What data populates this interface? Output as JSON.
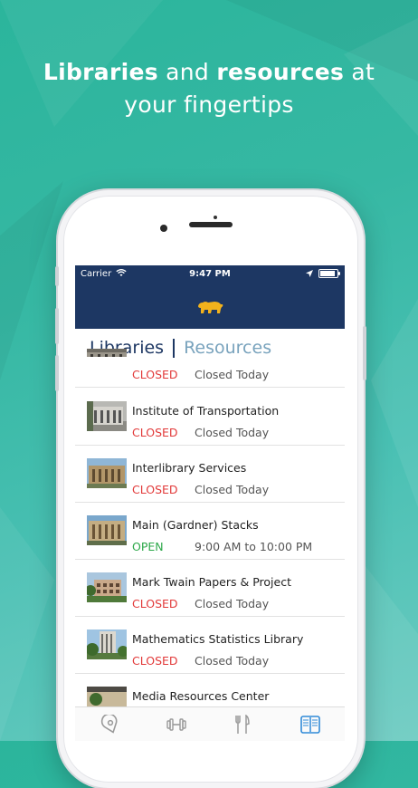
{
  "headline": {
    "line1_a": "Libraries",
    "line1_b": " and ",
    "line1_c": "resources",
    "line1_d": " at",
    "line2": "your fingertips"
  },
  "status_bar": {
    "carrier": "Carrier",
    "time": "9:47 PM"
  },
  "segmented": {
    "libraries": "Libraries",
    "resources": "Resources"
  },
  "libraries": [
    {
      "name": "",
      "state": "CLOSED",
      "state_type": "closed",
      "hours": "Closed Today",
      "icon": "building-photo"
    },
    {
      "name": "Institute of Transportation",
      "state": "CLOSED",
      "state_type": "closed",
      "hours": "Closed Today",
      "icon": "building-photo"
    },
    {
      "name": "Interlibrary Services",
      "state": "CLOSED",
      "state_type": "closed",
      "hours": "Closed Today",
      "icon": "building-photo"
    },
    {
      "name": "Main (Gardner) Stacks",
      "state": "OPEN",
      "state_type": "open",
      "hours": "9:00 AM to 10:00 PM",
      "icon": "building-photo"
    },
    {
      "name": "Mark Twain Papers & Project",
      "state": "CLOSED",
      "state_type": "closed",
      "hours": "Closed Today",
      "icon": "building-photo"
    },
    {
      "name": "Mathematics Statistics Library",
      "state": "CLOSED",
      "state_type": "closed",
      "hours": "Closed Today",
      "icon": "building-photo"
    },
    {
      "name": "Media Resources Center",
      "state": "",
      "state_type": "closed",
      "hours": "",
      "icon": "building-photo"
    }
  ],
  "colors": {
    "navy": "#1d3763",
    "closed": "#e23a3a",
    "open": "#2da84a",
    "accent_blue": "#2f8ad8"
  },
  "tabs": [
    {
      "icon": "location-pin-icon"
    },
    {
      "icon": "dumbbell-icon"
    },
    {
      "icon": "fork-knife-icon"
    },
    {
      "icon": "book-icon"
    }
  ]
}
